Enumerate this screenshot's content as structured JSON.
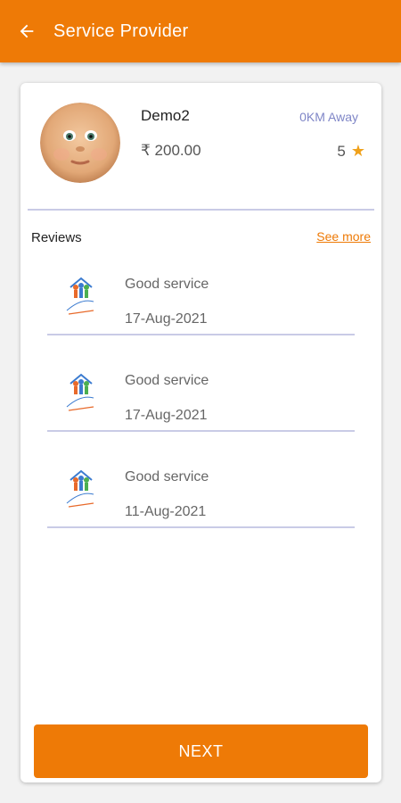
{
  "header": {
    "title": "Service Provider",
    "back_icon": "arrow-left-icon"
  },
  "provider": {
    "name": "Demo2",
    "distance": "0KM Away",
    "price": "₹ 200.00",
    "rating": "5",
    "rating_icon": "star-icon"
  },
  "reviews": {
    "label": "Reviews",
    "see_more": "See more",
    "items": [
      {
        "text": "Good service",
        "date": "17-Aug-2021"
      },
      {
        "text": "Good service",
        "date": "17-Aug-2021"
      },
      {
        "text": "Good service",
        "date": "11-Aug-2021"
      }
    ]
  },
  "footer": {
    "next_label": "NEXT"
  },
  "colors": {
    "primary": "#ee7a06",
    "accent_text": "#7f86c7",
    "star": "#f0a11a",
    "divider": "#c9cbe6"
  }
}
